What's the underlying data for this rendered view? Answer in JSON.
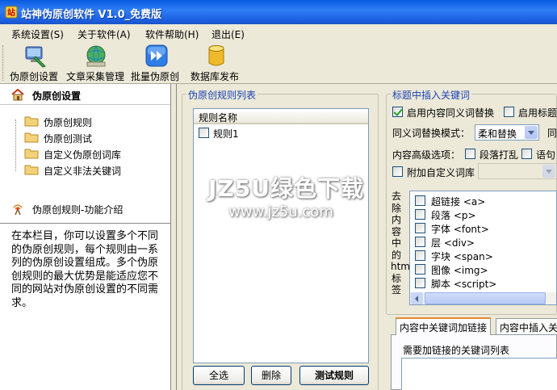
{
  "window": {
    "title": "站神伪原创软件 V1.0_免费版"
  },
  "menu": [
    {
      "label": "系统设置(S)"
    },
    {
      "label": "关于软件(A)"
    },
    {
      "label": "软件帮助(H)"
    },
    {
      "label": "退出(E)"
    }
  ],
  "toolbar": [
    {
      "label": "伪原创设置",
      "icon": "settings-icon"
    },
    {
      "label": "文章采集管理",
      "icon": "globe-icon"
    },
    {
      "label": "批量伪原创",
      "icon": "fast-forward-icon"
    },
    {
      "label": "数据库发布",
      "icon": "database-icon"
    }
  ],
  "sidebar": {
    "title": "伪原创设置",
    "items": [
      {
        "label": "伪原创规则"
      },
      {
        "label": "伪原创测试"
      },
      {
        "label": "自定义伪原创词库"
      },
      {
        "label": "自定义非法关键词"
      }
    ],
    "intro_title": "伪原创规则-功能介绍",
    "intro_text": "在本栏目，你可以设置多个不同的伪原创规则，每个规则由一系列的伪原创设置组成。多个伪原创规则的最大优势是能适应您不同的网站对伪原创设置的不同需求。"
  },
  "rules_panel": {
    "title": "伪原创规则列表",
    "column_header": "规则名称",
    "rows": [
      {
        "name": "规则1",
        "checked": false
      }
    ],
    "buttons": {
      "select_all": "全选",
      "delete": "删除",
      "test": "测试规则"
    }
  },
  "settings": {
    "title_group": "标题中插入关键词",
    "synonym_replace_label": "启用内容同义词替换",
    "synonym_replace_checked": true,
    "title_enable_label": "启用标题",
    "title_enable_checked": false,
    "mode_label": "同义词替换模式：",
    "mode_value": "柔和替换",
    "mode_suffix": "同",
    "advanced_label": "内容高级选项：",
    "shuffle_label": "段落打乱",
    "shuffle_checked": false,
    "sentence_label": "语句",
    "sentence_checked": false,
    "custom_lib_label": "附加自定义词库",
    "custom_lib_checked": false,
    "remove_tags_label": "去除内容中的html标签",
    "tags": [
      {
        "label": "超链接 <a>",
        "checked": false
      },
      {
        "label": "段落 <p>",
        "checked": false
      },
      {
        "label": "字体 <font>",
        "checked": false
      },
      {
        "label": "层 <div>",
        "checked": false
      },
      {
        "label": "字块 <span>",
        "checked": false
      },
      {
        "label": "图像 <img>",
        "checked": false
      },
      {
        "label": "脚本 <script>",
        "checked": false
      }
    ],
    "tabs": [
      {
        "label": "内容中关键词加链接"
      },
      {
        "label": "内容中插入关键"
      }
    ],
    "tab_content_label": "需要加链接的关键词列表"
  },
  "watermark": {
    "line1": "JZ5U绿色下载",
    "line2": "www.jz5u.com"
  },
  "colors": {
    "titlebar": "#2e7df4",
    "accent_blue": "#1c42b4",
    "background": "#ece9d8"
  }
}
